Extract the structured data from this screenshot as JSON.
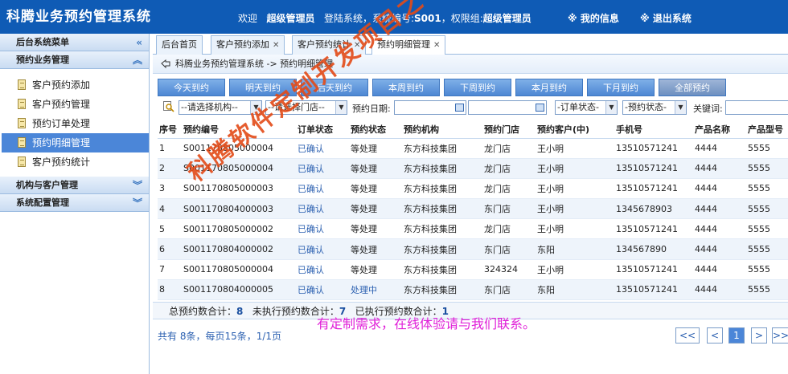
{
  "header": {
    "brand": "科腾业务预约管理系统",
    "welcome_prefix": "欢迎",
    "user_name": "超级管理员",
    "login_text": "登陆系统，系统编号:",
    "system_no": "S001",
    "role_text": "，权限组:",
    "role": "超级管理员",
    "my_info": "※ 我的信息",
    "logout": "※ 退出系统"
  },
  "sidebar": {
    "title": "后台系统菜单",
    "sections": [
      {
        "label": "预约业务管理",
        "expanded": true
      },
      {
        "label": "机构与客户管理",
        "expanded": false
      },
      {
        "label": "系统配置管理",
        "expanded": false
      }
    ],
    "items": [
      "客户预约添加",
      "客户预约管理",
      "预约订单处理",
      "预约明细管理",
      "客户预约统计"
    ],
    "active_item": "预约明细管理"
  },
  "tabs": [
    {
      "label": "后台首页",
      "closable": false
    },
    {
      "label": "客户预约添加",
      "closable": true
    },
    {
      "label": "客户预约统计",
      "closable": true
    },
    {
      "label": "预约明细管理",
      "closable": true,
      "active": true
    }
  ],
  "breadcrumb": "科腾业务预约管理系统 -> 预约明细管理",
  "filter_tabs": [
    "今天到约",
    "明天到约",
    "后天到约",
    "本周到约",
    "下周到约",
    "本月到约",
    "下月到约",
    "全部预约"
  ],
  "active_filter": "全部预约",
  "search": {
    "org_select": "--请选择机构--",
    "store_select": "--请选择门店--",
    "date_label": "预约日期:",
    "order_status_select": "-订单状态-",
    "appt_status_select": "-预约状态-",
    "keyword_label": "关键词:"
  },
  "table": {
    "headers": [
      "序号",
      "预约编号",
      "订单状态",
      "预约状态",
      "预约机构",
      "预约门店",
      "预约客户(中)",
      "手机号",
      "产品名称",
      "产品型号"
    ],
    "rows": [
      [
        "1",
        "S001170805000004",
        "已确认",
        "等处理",
        "东方科技集团",
        "龙门店",
        "王小明",
        "13510571241",
        "4444",
        "5555"
      ],
      [
        "2",
        "S001170805000004",
        "已确认",
        "等处理",
        "东方科技集团",
        "龙门店",
        "王小明",
        "13510571241",
        "4444",
        "5555"
      ],
      [
        "3",
        "S001170805000003",
        "已确认",
        "等处理",
        "东方科技集团",
        "龙门店",
        "王小明",
        "13510571241",
        "4444",
        "5555"
      ],
      [
        "4",
        "S001170804000003",
        "已确认",
        "等处理",
        "东方科技集团",
        "东门店",
        "王小明",
        "1345678903",
        "4444",
        "5555"
      ],
      [
        "5",
        "S001170805000002",
        "已确认",
        "等处理",
        "东方科技集团",
        "龙门店",
        "王小明",
        "13510571241",
        "4444",
        "5555"
      ],
      [
        "6",
        "S001170804000002",
        "已确认",
        "等处理",
        "东方科技集团",
        "东门店",
        "东阳",
        "134567890",
        "4444",
        "5555"
      ],
      [
        "7",
        "S001170805000004",
        "已确认",
        "等处理",
        "东方科技集团",
        "324324",
        "王小明",
        "13510571241",
        "4444",
        "5555"
      ],
      [
        "8",
        "S001170804000005",
        "已确认",
        "处理中",
        "东方科技集团",
        "东门店",
        "东阳",
        "13510571241",
        "4444",
        "5555"
      ]
    ]
  },
  "totals": {
    "total_label": "总预约数合计：",
    "total_value": "8",
    "pending_label": "未执行预约数合计：",
    "pending_value": "7",
    "done_label": "已执行预约数合计：",
    "done_value": "1"
  },
  "pager": {
    "info": "共有 8条，每页15条，1/1页",
    "first": "<<",
    "prev": "<",
    "current": "1",
    "next": ">",
    "last": ">>"
  },
  "contact_note": "有定制需求，在线体验请与我们联系。",
  "watermark": "科腾软件定制开发项目之一"
}
